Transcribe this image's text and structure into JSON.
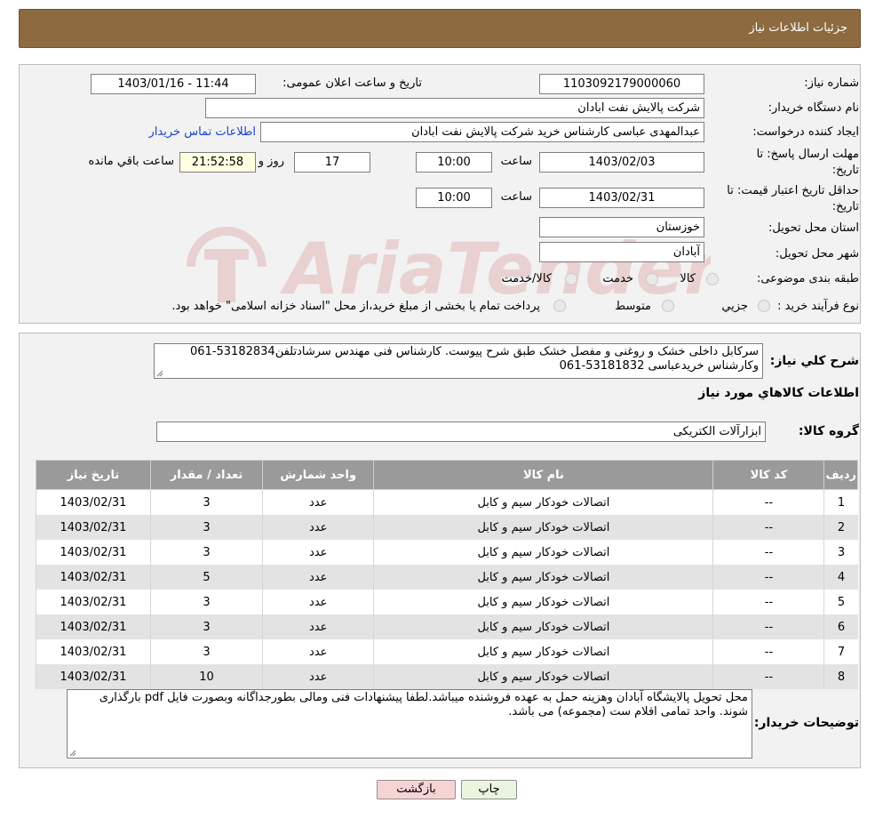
{
  "header": {
    "title": "جزئیات اطلاعات نیاز"
  },
  "form": {
    "need_number_label": "شماره نیاز:",
    "need_number": "1103092179000060",
    "announce_label": "تاریخ و ساعت اعلان عمومی:",
    "announce_value": "1403/01/16 - 11:44",
    "buyer_org_label": "نام دستگاه خریدار:",
    "buyer_org": "شرکت پالایش نفت ابادان",
    "requester_label": "ایجاد کننده درخواست:",
    "requester": "عبدالمهدی  عباسی کارشناس خرید شرکت پالایش نفت ابادان",
    "contact_link": "اطلاعات تماس خریدار",
    "deadline_label_1": "مهلت ارسال پاسخ: تا",
    "deadline_label_2": "تاریخ:",
    "deadline_date": "1403/02/03",
    "time_label": "ساعت",
    "deadline_time": "10:00",
    "days_value": "17",
    "days_label": "روز و",
    "remaining_time": "21:52:58",
    "remaining_label": "ساعت باقي مانده",
    "validity_label_1": "حداقل تاریخ اعتبار قیمت: تا",
    "validity_label_2": "تاریخ:",
    "validity_date": "1403/02/31",
    "validity_time": "10:00",
    "province_label": "استان محل تحویل:",
    "province": "خوزستان",
    "city_label": "شهر محل تحویل:",
    "city": "آبادان",
    "category_label": "طبقه بندی موضوعی:",
    "category_options": [
      "کالا",
      "خدمت",
      "کالا/خدمت"
    ],
    "process_label": "نوع فرآیند خرید :",
    "process_options": [
      "جزیي",
      "متوسط"
    ],
    "process_note": "پرداخت تمام یا بخشی از مبلغ خرید،از محل \"اسناد خزانه اسلامی\" خواهد بود."
  },
  "summary": {
    "label": "شرح کلي نياز:",
    "text": "سرکابل داخلی خشک و روغنی و مفصل خشک طبق شرح پیوست. کارشناس فنی مهندس سرشادتلفن53182834-061 وکارشناس خریدعباسی 53181832-061",
    "items_title": "اطلاعات کالاهاي مورد نياز",
    "group_label": "گروه کالا:",
    "group_value": "ابزارآلات الکتریکی"
  },
  "table": {
    "headers": [
      "رديف",
      "کد کالا",
      "نام کالا",
      "واحد شمارش",
      "تعداد / مقدار",
      "تاریخ نیاز"
    ],
    "rows": [
      [
        "1",
        "--",
        "اتصالات خودکار سیم و کابل",
        "عدد",
        "3",
        "1403/02/31"
      ],
      [
        "2",
        "--",
        "اتصالات خودکار سیم و کابل",
        "عدد",
        "3",
        "1403/02/31"
      ],
      [
        "3",
        "--",
        "اتصالات خودکار سیم و کابل",
        "عدد",
        "3",
        "1403/02/31"
      ],
      [
        "4",
        "--",
        "اتصالات خودکار سیم و کابل",
        "عدد",
        "5",
        "1403/02/31"
      ],
      [
        "5",
        "--",
        "اتصالات خودکار سیم و کابل",
        "عدد",
        "3",
        "1403/02/31"
      ],
      [
        "6",
        "--",
        "اتصالات خودکار سیم و کابل",
        "عدد",
        "3",
        "1403/02/31"
      ],
      [
        "7",
        "--",
        "اتصالات خودکار سیم و کابل",
        "عدد",
        "3",
        "1403/02/31"
      ],
      [
        "8",
        "--",
        "اتصالات خودکار سیم و کابل",
        "عدد",
        "10",
        "1403/02/31"
      ]
    ]
  },
  "buyer_notes": {
    "label": "توضیحات خریدار:",
    "text": "محل تحویل پالایشگاه آبادان وهزینه حمل به عهده فروشنده میباشد.لطفا پیشنهادات فنی ومالی بطورجداگانه وبصورت فایل pdf بارگذاری شوند. واحد تمامی اقلام ست (مجموعه) می باشد."
  },
  "buttons": {
    "print": "چاپ",
    "back": "بازگشت"
  },
  "watermark": {
    "text": "AriaTender.neT"
  },
  "colors": {
    "header_bg": "#8d6a3f",
    "link": "#1a3fd1",
    "back_button_bg": "#f7d4d4",
    "print_button_bg": "#eaf5e0"
  }
}
